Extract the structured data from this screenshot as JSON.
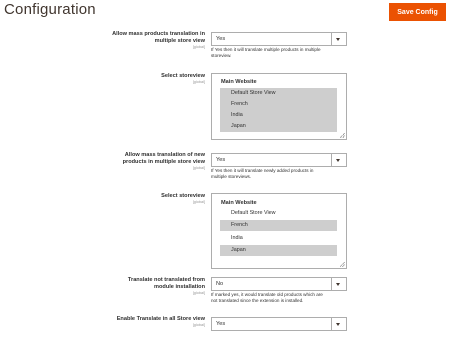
{
  "header": {
    "title": "Configuration",
    "save_label": "Save Config"
  },
  "scope_global": "[global]",
  "fields": [
    {
      "label_line1": "Allow mass products translation in",
      "label_line2": "multiple store view",
      "value": "Yes",
      "note_line1": "If Yes then it will translate multiple products in multiple",
      "note_line2": "storeview."
    },
    {
      "label_line1": "Select storeview",
      "group": "Main Website",
      "options": [
        {
          "label": "Default Store View",
          "selected": true
        },
        {
          "label": "French",
          "selected": true
        },
        {
          "label": "India",
          "selected": true
        },
        {
          "label": "Japan",
          "selected": true
        }
      ]
    },
    {
      "label_line1": "Allow mass translation of new",
      "label_line2": "products in multiple store view",
      "value": "Yes",
      "note_line1": "If Yes then it will translate newly added products in",
      "note_line2": "multiple storeviews."
    },
    {
      "label_line1": "Select storeview",
      "group": "Main Website",
      "options": [
        {
          "label": "Default Store View",
          "selected": false
        },
        {
          "label": "French",
          "selected": true
        },
        {
          "label": "India",
          "selected": false
        },
        {
          "label": "Japan",
          "selected": true
        }
      ]
    },
    {
      "label_line1": "Translate not translated from",
      "label_line2": "module installation",
      "value": "No",
      "note_line1": "If marked yes, it would translate old products which are",
      "note_line2": "not translated since the extension is installed."
    },
    {
      "label_line1": "Enable Translate in all Store view",
      "value": "Yes"
    }
  ],
  "colors": {
    "accent": "#eb5202",
    "selected_option": "#cecece"
  }
}
